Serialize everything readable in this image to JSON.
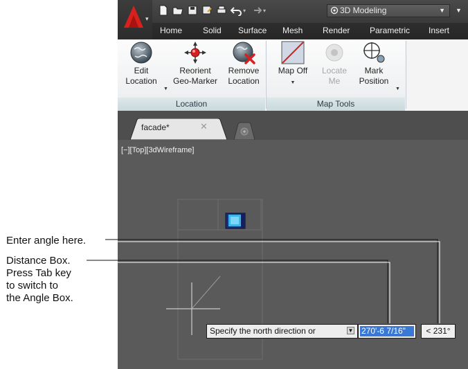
{
  "app": {
    "workspace": "3D Modeling",
    "ribbon_tabs": [
      "Home",
      "Solid",
      "Surface",
      "Mesh",
      "Render",
      "Parametric",
      "Insert"
    ],
    "panels": {
      "location": {
        "title": "Location",
        "buttons": [
          {
            "line1": "Edit",
            "line2": "Location",
            "icon": "globe-icon"
          },
          {
            "line1": "Reorient",
            "line2": "Geo-Marker",
            "icon": "geo-marker-icon"
          },
          {
            "line1": "Remove",
            "line2": "Location",
            "icon": "globe-remove-icon"
          }
        ]
      },
      "map_tools": {
        "title": "Map Tools",
        "buttons": [
          {
            "line1": "Map Off",
            "line2": "",
            "icon": "map-off-icon"
          },
          {
            "line1": "Locate",
            "line2": "Me",
            "icon": "locate-me-icon"
          },
          {
            "line1": "Mark",
            "line2": "Position",
            "icon": "mark-position-icon"
          }
        ]
      }
    },
    "file_tab": "facade*",
    "viewport_label": "[−][Top][3dWireframe]",
    "command_prompt": "Specify the north direction or",
    "distance_value": "270'-6 7/16\"",
    "angle_value": "< 231°"
  },
  "callouts": {
    "angle": "Enter angle here.",
    "distance": [
      "Distance Box.",
      "Press Tab key",
      "to switch to",
      "the Angle Box."
    ]
  }
}
